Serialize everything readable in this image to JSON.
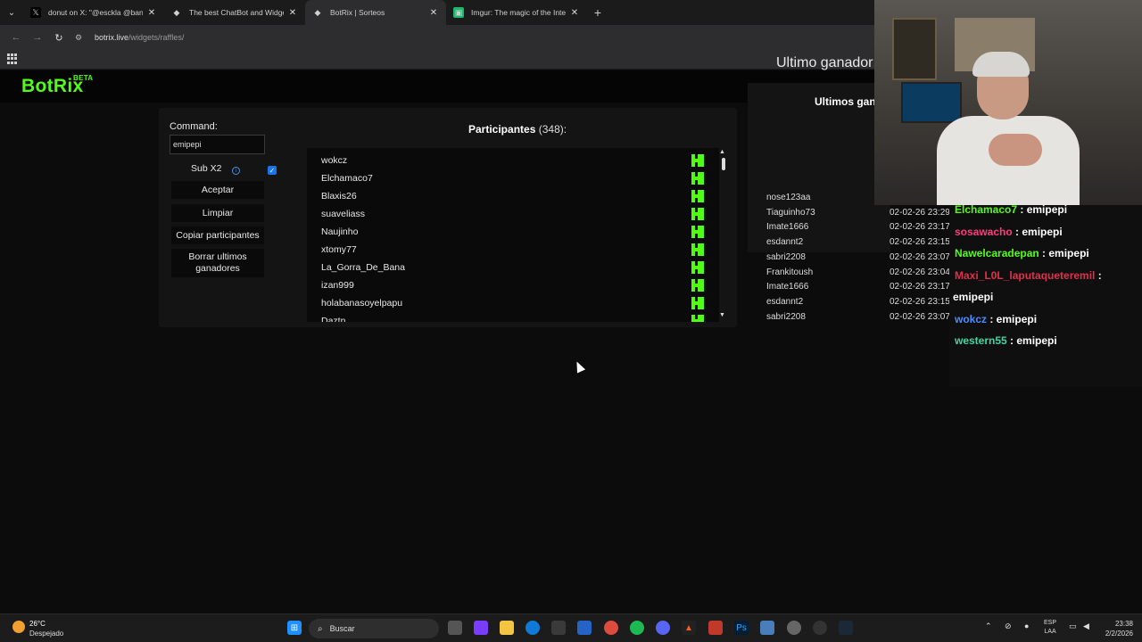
{
  "browser": {
    "tabs": [
      {
        "title": "donut on X: \"@esckla @banan",
        "fav": "𝕏",
        "fav_bg": "#000000",
        "active": false
      },
      {
        "title": "The best ChatBot and Widgets",
        "fav": "◆",
        "fav_bg": "#1b1b1c",
        "active": false
      },
      {
        "title": "BotRix | Sorteos",
        "fav": "◆",
        "fav_bg": "#2d2d2f",
        "active": true
      },
      {
        "title": "Imgur: The magic of the Interne",
        "fav": "▣",
        "fav_bg": "#1bb76e",
        "active": false
      }
    ],
    "close_glyph": "✕",
    "new_tab_glyph": "+",
    "url_domain": "botrix.live",
    "url_path": "/widgets/raffles/"
  },
  "site": {
    "logo": "BotRix",
    "logo_badge": "BETA"
  },
  "raffle": {
    "command_label": "Command:",
    "command_value": "emipepi",
    "sub_label": "Sub X2",
    "sub_checked": true,
    "buttons": {
      "accept": "Aceptar",
      "clear": "Limpiar",
      "copy": "Copiar participantes",
      "delete_winners": "Borrar ultimos ganadores"
    },
    "participants_title": "Participantes",
    "participants_count": "(348):",
    "participants": [
      "wokcz",
      "Elchamaco7",
      "Blaxis26",
      "suaveliass",
      "Naujinho",
      "xtomy77",
      "La_Gorra_De_Bana",
      "izan999",
      "holabanasoyelpapu",
      "Daztn"
    ]
  },
  "winners": {
    "last_winner_label": "Ultimo ganador:",
    "title": "Ultimos gan",
    "entries": [
      {
        "name": "nose123aa",
        "date": ""
      },
      {
        "name": "Tiaguinho73",
        "date": "02-02-26 23:29"
      },
      {
        "name": "Imate1666",
        "date": "02-02-26 23:17"
      },
      {
        "name": "esdannt2",
        "date": "02-02-26 23:15"
      },
      {
        "name": "sabri2208",
        "date": "02-02-26 23:07"
      },
      {
        "name": "Frankitoush",
        "date": "02-02-26 23:04"
      },
      {
        "name": "Imate1666",
        "date": "02-02-26 23:17"
      },
      {
        "name": "esdannt2",
        "date": "02-02-26 23:15"
      },
      {
        "name": "sabri2208",
        "date": "02-02-26 23:07"
      }
    ]
  },
  "chat": {
    "messages": [
      {
        "user": "Elchamaco7",
        "text": " : emipepi",
        "color": "#53fc18"
      },
      {
        "user": "sosawacho",
        "text": " : emipepi",
        "color": "#ff3c7a"
      },
      {
        "user": "Nawelcaradepan",
        "text": " : emipepi",
        "color": "#53fc18"
      },
      {
        "user": "Maxi_L0L_laputaqueteremil",
        "text": " :",
        "color": "#e0304a"
      },
      {
        "user": "",
        "text": "emipepi",
        "color": "#ffffff"
      },
      {
        "user": "wokcz",
        "text": " : emipepi",
        "color": "#4a8cff"
      },
      {
        "user": "western55",
        "text": " : emipepi",
        "color": "#3fd6a0"
      }
    ]
  },
  "taskbar": {
    "temperature": "26°C",
    "condition": "Despejado",
    "search_placeholder": "Buscar",
    "lang_line1": "ESP",
    "lang_line2": "LAA",
    "time": "23:38",
    "date": "2/2/2026"
  },
  "colors": {
    "kick_green": "#53fc18",
    "checkbox_blue": "#1a73e8"
  }
}
